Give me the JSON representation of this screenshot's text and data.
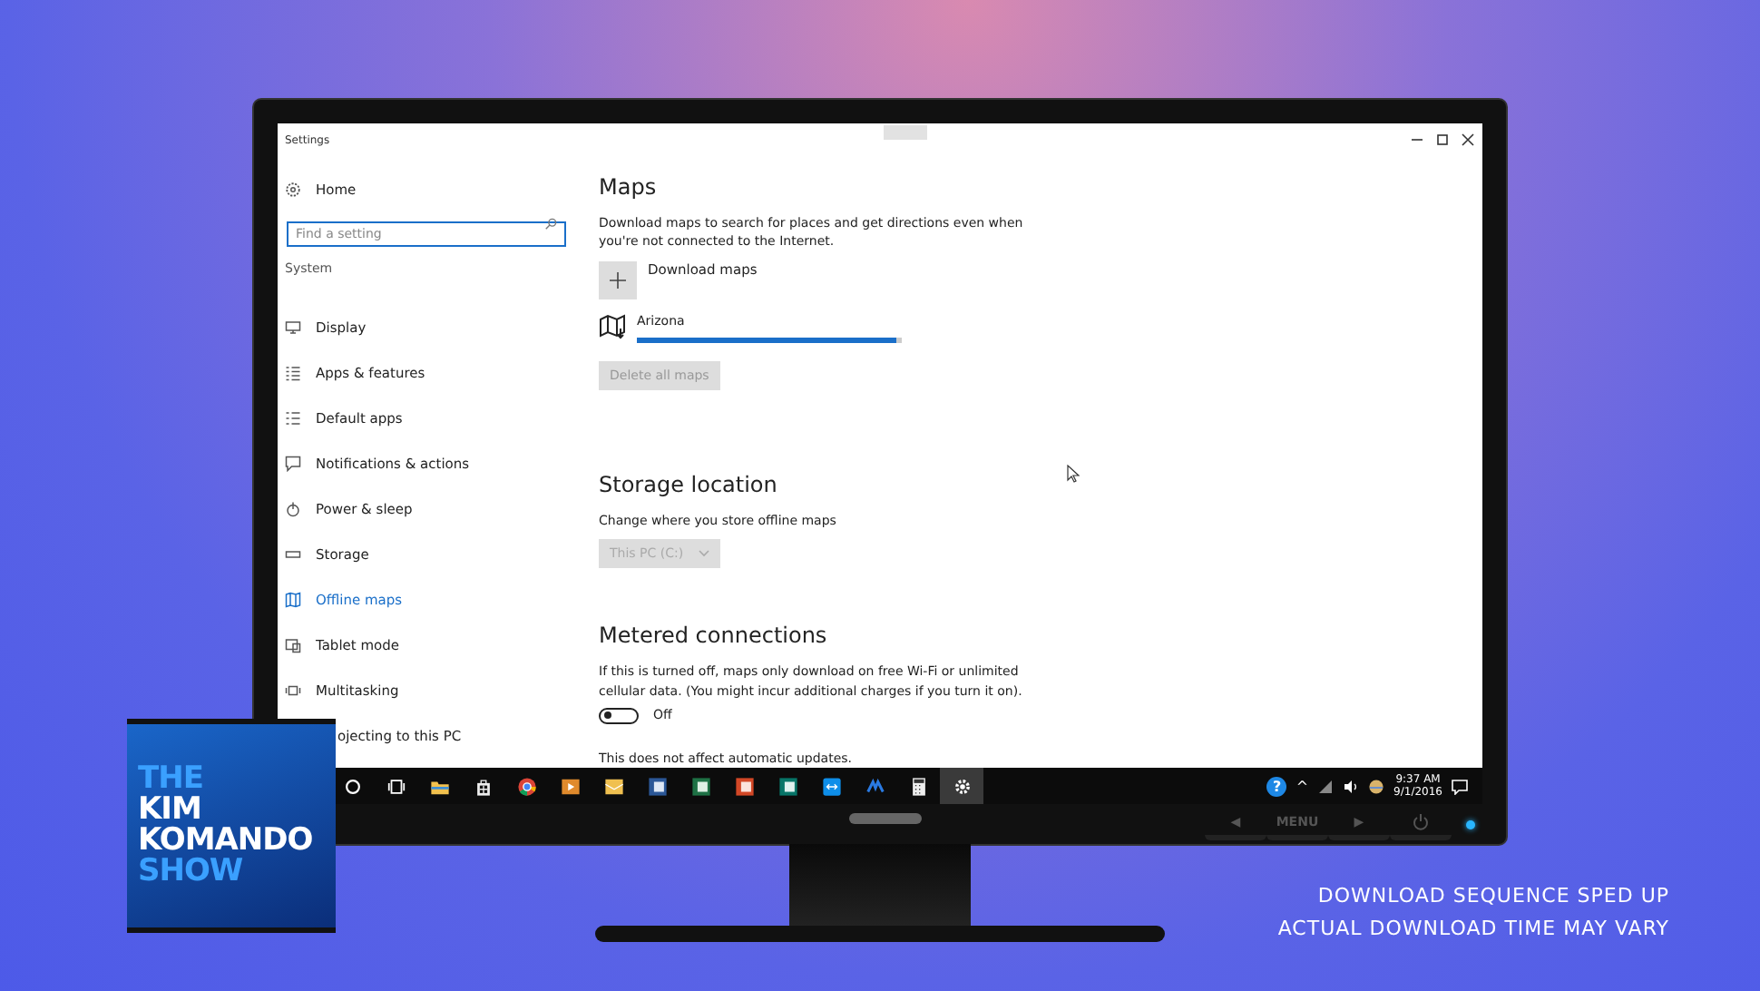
{
  "window": {
    "title": "Settings"
  },
  "sidebar": {
    "home": "Home",
    "search": {
      "placeholder": "Find a setting"
    },
    "section": "System",
    "items": [
      {
        "label": "Display",
        "kind": "display",
        "selected": false
      },
      {
        "label": "Apps & features",
        "kind": "apps",
        "selected": false
      },
      {
        "label": "Default apps",
        "kind": "defaults",
        "selected": false
      },
      {
        "label": "Notifications & actions",
        "kind": "notifications",
        "selected": false
      },
      {
        "label": "Power & sleep",
        "kind": "power",
        "selected": false
      },
      {
        "label": "Storage",
        "kind": "storage",
        "selected": false
      },
      {
        "label": "Offline maps",
        "kind": "maps",
        "selected": true
      },
      {
        "label": "Tablet mode",
        "kind": "tablet",
        "selected": false
      },
      {
        "label": "Multitasking",
        "kind": "multitasking",
        "selected": false
      },
      {
        "label": "ojecting to this PC",
        "kind": "none",
        "selected": false
      }
    ]
  },
  "maps": {
    "heading": "Maps",
    "description": "Download maps to search for places and get directions even when you're not connected to the Internet.",
    "download_button": "Download maps",
    "map": {
      "name": "Arizona",
      "level": 0.98
    },
    "delete_button": {
      "label": "Delete all maps",
      "disabled": true
    }
  },
  "storage": {
    "heading": "Storage location",
    "description": "Change where you store offline maps",
    "dropdown": {
      "value": "This PC (C:)",
      "disabled": true
    }
  },
  "metered": {
    "heading": "Metered connections",
    "description": "If this is turned off, maps only download on free Wi-Fi or unlimited cellular data. (You might incur additional charges if you turn it on).",
    "toggle": {
      "on": false,
      "label": "Off"
    },
    "note": "This does not affect automatic updates."
  },
  "taskbar": {
    "apps": [
      {
        "kind": "cortana",
        "selected": false
      },
      {
        "kind": "taskview",
        "selected": false
      },
      {
        "kind": "folder",
        "selected": false
      },
      {
        "kind": "store",
        "selected": false
      },
      {
        "kind": "browser",
        "selected": false
      },
      {
        "kind": "media",
        "selected": false
      },
      {
        "kind": "mail",
        "selected": false
      },
      {
        "kind": "word",
        "selected": false
      },
      {
        "kind": "excel",
        "selected": false
      },
      {
        "kind": "powerpoint",
        "selected": false
      },
      {
        "kind": "publisher",
        "selected": false
      },
      {
        "kind": "remote",
        "selected": false
      },
      {
        "kind": "shield",
        "selected": false
      },
      {
        "kind": "calculator",
        "selected": false
      },
      {
        "kind": "settings",
        "selected": true
      }
    ],
    "help": "?",
    "chevron": "^",
    "time": "9:37 AM",
    "date": "9/1/2016"
  },
  "monitor": {
    "left": "◀",
    "menu": "MENU",
    "right": "▶"
  },
  "logo": {
    "lines": [
      {
        "text": "THE",
        "kind": "accent"
      },
      {
        "text": "KIM",
        "kind": "plain"
      },
      {
        "text": "KOMANDO",
        "kind": "plain"
      },
      {
        "text": "SHOW",
        "kind": "accent"
      }
    ]
  },
  "caption": [
    "DOWNLOAD SEQUENCE SPED UP",
    "ACTUAL DOWNLOAD TIME MAY VARY"
  ]
}
